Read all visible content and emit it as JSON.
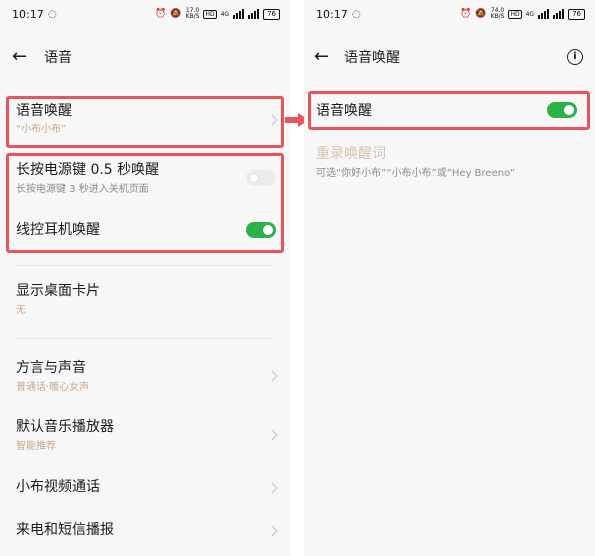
{
  "left": {
    "status": {
      "time": "10:17",
      "speed_top": "17.0",
      "speed_unit": "KB/S",
      "net": "4G",
      "hd": "HD",
      "battery": "76"
    },
    "header": {
      "title": "语音"
    },
    "voice_wake": {
      "label": "语音唤醒",
      "sub": "“小布小布”"
    },
    "power_key": {
      "label": "长按电源键 0.5 秒唤醒",
      "sub": "长按电源键 3 秒进入关机页面",
      "enabled": false
    },
    "wired_headset": {
      "label": "线控耳机唤醒",
      "enabled": true
    },
    "desktop_card": {
      "label": "显示桌面卡片",
      "sub": "无"
    },
    "dialect": {
      "label": "方言与声音",
      "sub": "普通话·暖心女声"
    },
    "music_player": {
      "label": "默认音乐播放器",
      "sub": "智能推荐"
    },
    "video_call": {
      "label": "小布视频通话"
    },
    "call_sms": {
      "label": "来电和短信播报"
    }
  },
  "right": {
    "status": {
      "time": "10:17",
      "speed_top": "74.0",
      "speed_unit": "KB/S",
      "net": "4G",
      "hd": "HD",
      "battery": "76"
    },
    "header": {
      "title": "语音唤醒"
    },
    "voice_wake": {
      "label": "语音唤醒",
      "enabled": true
    },
    "rerecord": {
      "label": "重录唤醒词",
      "sub": "可选“你好小布”“小布小布”或“Hey Breeno”"
    }
  },
  "colors": {
    "highlight": "#e8555c",
    "toggle_on": "#2bb04a",
    "accent_sub": "#c9a88a"
  },
  "icons": [
    "back-arrow-icon",
    "info-icon",
    "chevron-right-icon",
    "alarm-icon",
    "mute-icon",
    "signal-icon",
    "battery-icon"
  ]
}
